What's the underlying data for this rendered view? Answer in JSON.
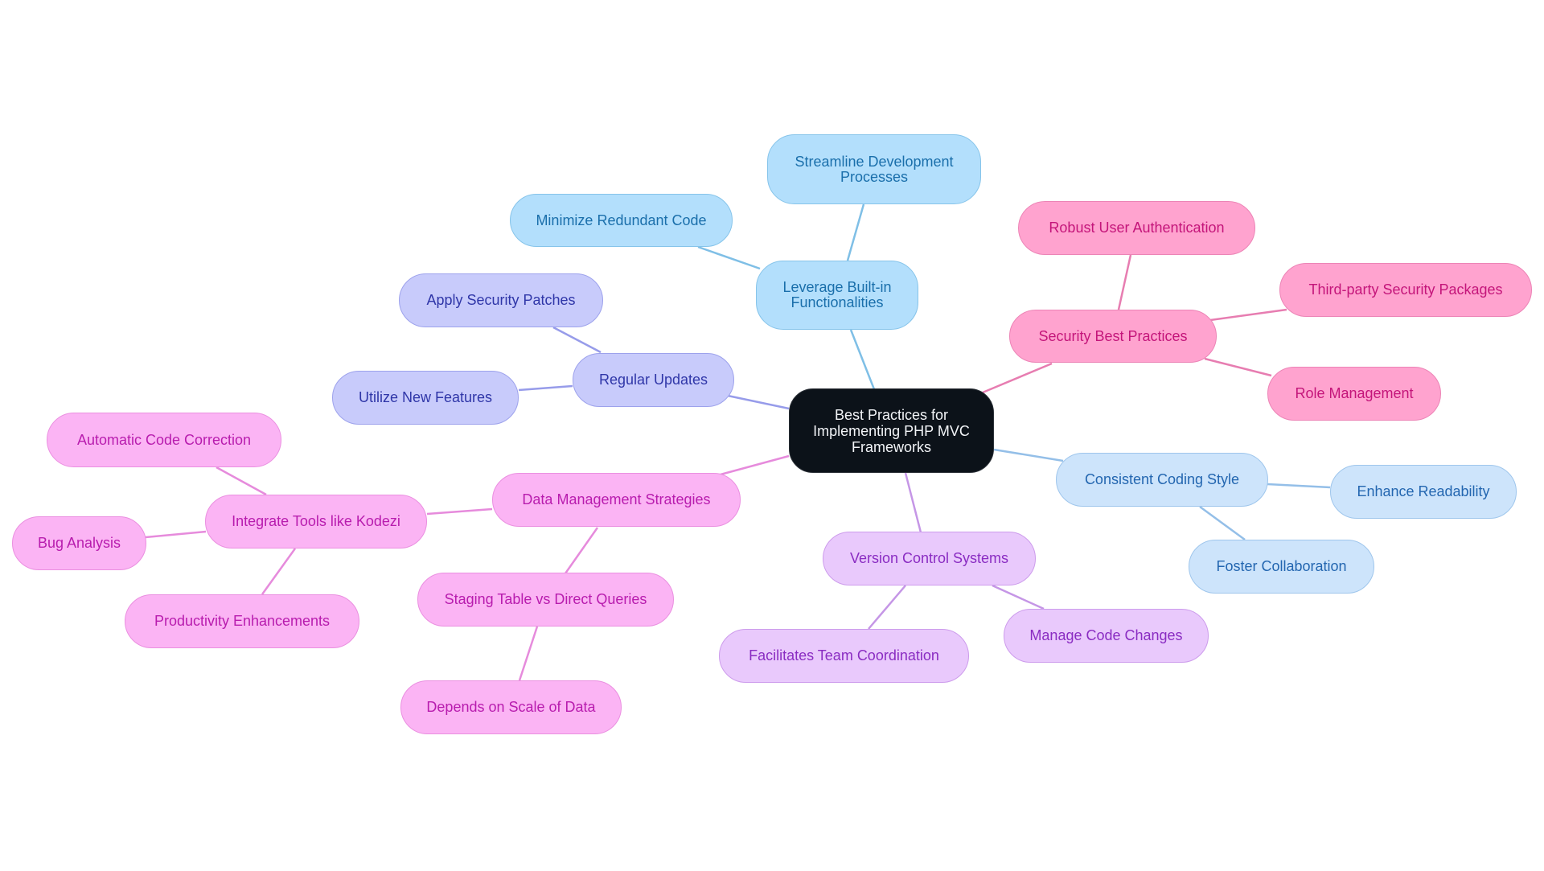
{
  "title": "Best Practices for Implementing PHP MVC Frameworks",
  "colors": {
    "sky": "#7fbfe6",
    "pink": "#e77db1",
    "blue": "#94bfe8",
    "violet": "#c596e6",
    "indigo": "#979cea",
    "magenta": "#e68bdc"
  },
  "nodes": {
    "root": "Best Practices for Implementing PHP MVC Frameworks",
    "leverage": "Leverage Built-in Functionalities",
    "streamline": "Streamline Development Processes",
    "minimize": "Minimize Redundant Code",
    "security": "Security Best Practices",
    "auth": "Robust User Authentication",
    "thirdparty": "Third-party Security Packages",
    "role": "Role Management",
    "coding": "Consistent Coding Style",
    "readability": "Enhance Readability",
    "collab": "Foster Collaboration",
    "vcs": "Version Control Systems",
    "coordination": "Facilitates Team Coordination",
    "changes": "Manage Code Changes",
    "updates": "Regular Updates",
    "patches": "Apply Security Patches",
    "features": "Utilize New Features",
    "datamgmt": "Data Management Strategies",
    "staging": "Staging Table vs Direct Queries",
    "scale": "Depends on Scale of Data",
    "kodezi": "Integrate Tools like Kodezi",
    "autocorrect": "Automatic Code Correction",
    "bug": "Bug Analysis",
    "productivity": "Productivity Enhancements"
  }
}
